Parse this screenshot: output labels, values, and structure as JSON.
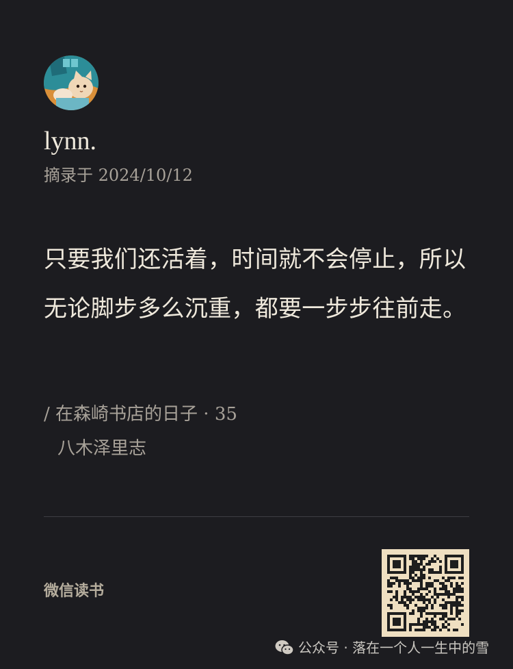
{
  "profile": {
    "username": "lynn.",
    "excerpt_date": "摘录于 2024/10/12"
  },
  "quote": {
    "text": "只要我们还活着，时间就不会停止，所以无论脚步多么沉重，都要一步步往前走。"
  },
  "book": {
    "title_line": "/ 在森崎书店的日子 · 35",
    "author": "八木泽里志"
  },
  "footer": {
    "brand": "微信读书",
    "qr_icon": "qr-code",
    "watermark": "公众号 · 落在一个人一生中的雪",
    "watermark_icon": "wechat-icon"
  },
  "colors": {
    "background": "#1c1c20",
    "primary_text": "#efe9dc",
    "secondary_text": "#a8a299",
    "qr_background": "#efdfc1"
  }
}
